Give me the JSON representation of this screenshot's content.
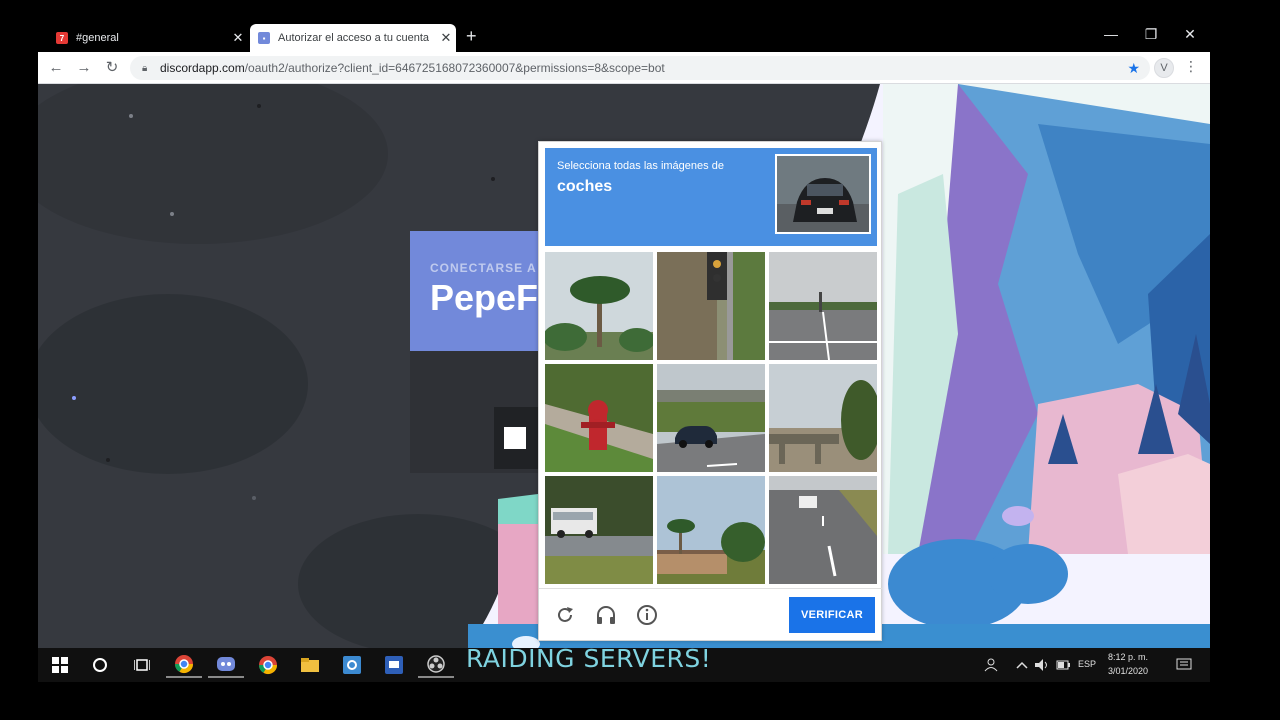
{
  "browser": {
    "tabs": [
      {
        "title": "#general",
        "active": false,
        "icon": "discord-app-icon"
      },
      {
        "title": "Autorizar el acceso a tu cuenta",
        "active": true,
        "icon": "discord-icon"
      }
    ],
    "address": {
      "host": "discordapp.com",
      "path": "/oauth2/authorize?client_id=646725168072360007&permissions=8&scope=bot"
    },
    "profile_initial": "V"
  },
  "authorize": {
    "subtitle": "CONECTARSE A D",
    "app_name": "PepeF"
  },
  "captcha": {
    "instruction": "Selecciona todas las imágenes de",
    "target": "coches",
    "verify_label": "VERIFICAR",
    "tiles": [
      "palm-tree",
      "traffic-light",
      "road-intersection",
      "fire-hydrant",
      "car-under-bridge",
      "highway-bridge",
      "white-van",
      "palm-houses",
      "car-on-highway"
    ]
  },
  "overlay": {
    "caption": "RAIDING SERVERS!"
  },
  "taskbar": {
    "language": "ESP",
    "time": "8:12 p. m.",
    "date": "3/01/2020"
  },
  "colors": {
    "discord_blurple": "#7289da",
    "captcha_blue": "#4a90e2",
    "verify_blue": "#1a73e8",
    "caption_cyan": "#7fd3e0"
  }
}
